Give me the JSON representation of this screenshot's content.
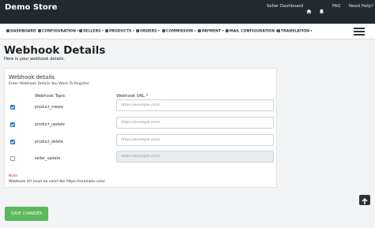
{
  "header": {
    "brand": "Demo Store",
    "links": {
      "dashboard": "Seller Dashboard",
      "faq": "FAQ",
      "help": "Need Help?"
    }
  },
  "nav": {
    "items": [
      {
        "label": "DASHBOARD",
        "caret": ""
      },
      {
        "label": "CONFIGURATION",
        "caret": "▾"
      },
      {
        "label": "SELLERS",
        "caret": "▾"
      },
      {
        "label": "PRODUCTS",
        "caret": "▾"
      },
      {
        "label": "ORDERS",
        "caret": "▾"
      },
      {
        "label": "COMMISSION",
        "caret": "▾"
      },
      {
        "label": "PAYMENT",
        "caret": "▾"
      },
      {
        "label": "MAIL CONFIGURATION",
        "caret": "▾"
      },
      {
        "label": "TRANSLATION",
        "caret": "▾"
      }
    ]
  },
  "page": {
    "title": "Webhook Details",
    "subtitle": "Here is your webhook details."
  },
  "card": {
    "title": "Webhook details",
    "subtitle": "Enter Webhook Details You Want To Register.",
    "col_topic": "Webhook Topic",
    "col_url": "Webhook URL *",
    "rows": [
      {
        "topic": "product_create",
        "placeholder": "https://example.com/",
        "checked": true
      },
      {
        "topic": "product_update",
        "placeholder": "https://example.com/",
        "checked": true
      },
      {
        "topic": "product_delete",
        "placeholder": "https://example.com/",
        "checked": true
      },
      {
        "topic": "seller_update",
        "placeholder": "https://example.com/",
        "checked": false
      }
    ],
    "note_label": "Note:",
    "note_text": "Webhook Url must be valid like https://example.com/"
  },
  "save_label": "SAVE CHANGES",
  "icons": {
    "home": "home-icon",
    "bell": "bell-icon",
    "menu": "menu-icon",
    "check": "check-icon",
    "arrow_up": "arrow-up-icon"
  },
  "colors": {
    "topbar": "#1f2a33",
    "primary": "#2a81cc",
    "save": "#5cb85c",
    "note": "#c0392b"
  }
}
